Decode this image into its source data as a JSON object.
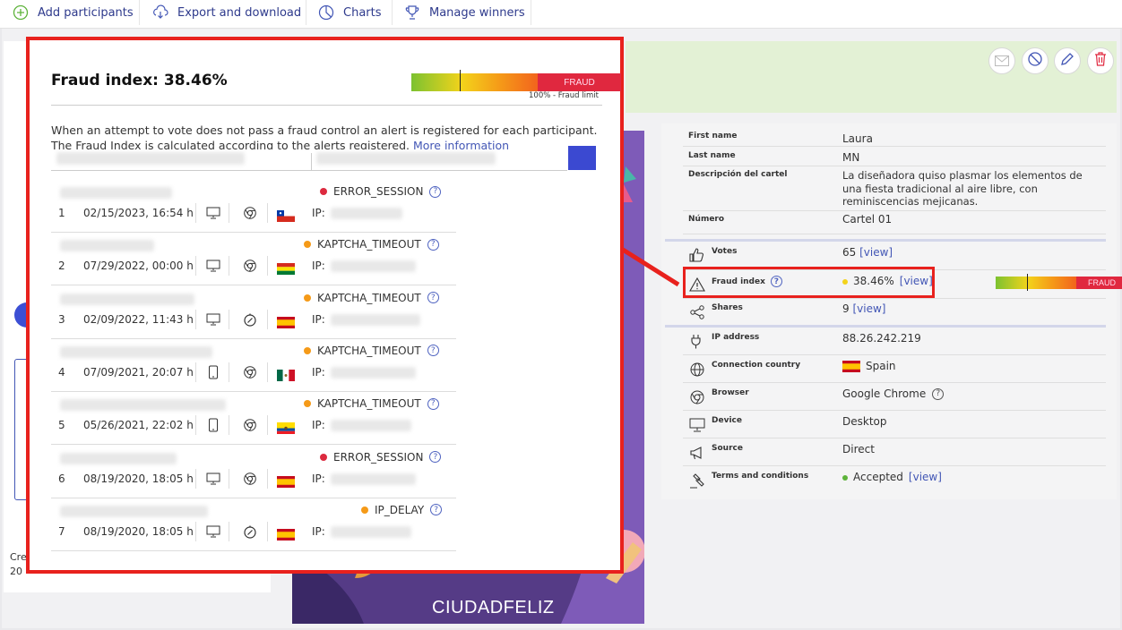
{
  "toolbar": {
    "items": [
      {
        "label": "Add participants",
        "icon": "plus-circle-icon"
      },
      {
        "label": "Export and download",
        "icon": "cloud-download-icon"
      },
      {
        "label": "Charts",
        "icon": "pie-chart-icon"
      },
      {
        "label": "Manage winners",
        "icon": "trophy-icon"
      }
    ]
  },
  "actions": [
    "mail-icon",
    "block-icon",
    "edit-icon",
    "delete-icon"
  ],
  "left_text": {
    "line1": "Cre",
    "line2": "20"
  },
  "poster": {
    "caption": "CIUDADFELIZ"
  },
  "details": {
    "first_name_label": "First name",
    "first_name": "Laura",
    "last_name_label": "Last name",
    "last_name": "MN",
    "desc_label": "Descripción del cartel",
    "desc": "La diseñadora quiso plasmar los elementos de una fiesta tradicional al aire libre, con reminiscencias mejicanas.",
    "number_label": "Número",
    "number": "Cartel 01",
    "votes_label": "Votes",
    "votes": "65",
    "fraud_label": "Fraud index",
    "fraud_value": "38.46%",
    "shares_label": "Shares",
    "shares": "9",
    "ip_label": "IP address",
    "ip": "88.26.242.219",
    "country_label": "Connection country",
    "country": "Spain",
    "browser_label": "Browser",
    "browser": "Google Chrome",
    "device_label": "Device",
    "device": "Desktop",
    "source_label": "Source",
    "source": "Direct",
    "terms_label": "Terms and conditions",
    "terms": "Accepted",
    "view_link": "[view]",
    "fraud_tag": "FRAUD",
    "fraud_level": 0.3846
  },
  "modal": {
    "title": "Fraud index: 38.46%",
    "gauge_fraud": "FRAUD",
    "gauge_limit": "100% - Fraud limit",
    "desc": "When an attempt to vote does not pass a fraud control an alert is registered for each participant. The Fraud Index is calculated according to the alerts registered.",
    "more_link": "More information",
    "ip_label": "IP:",
    "rows": [
      {
        "num": "1",
        "date": "02/15/2023, 16:54 h",
        "alert": "ERROR_SESSION",
        "alert_color": "#dc2a3f",
        "device": "desktop-icon",
        "browser": "chrome-icon",
        "flag": "chile-flag-icon"
      },
      {
        "num": "2",
        "date": "07/29/2022, 00:00 h",
        "alert": "KAPTCHA_TIMEOUT",
        "alert_color": "#f59a18",
        "device": "desktop-icon",
        "browser": "chrome-icon",
        "flag": "bolivia-flag-icon"
      },
      {
        "num": "3",
        "date": "02/09/2022, 11:43 h",
        "alert": "KAPTCHA_TIMEOUT",
        "alert_color": "#f59a18",
        "device": "desktop-icon",
        "browser": "safari-icon",
        "flag": "spain-flag-icon"
      },
      {
        "num": "4",
        "date": "07/09/2021, 20:07 h",
        "alert": "KAPTCHA_TIMEOUT",
        "alert_color": "#f59a18",
        "device": "mobile-icon",
        "browser": "chrome-icon",
        "flag": "mexico-flag-icon"
      },
      {
        "num": "5",
        "date": "05/26/2021, 22:02 h",
        "alert": "KAPTCHA_TIMEOUT",
        "alert_color": "#f59a18",
        "device": "mobile-icon",
        "browser": "chrome-icon",
        "flag": "ecuador-flag-icon"
      },
      {
        "num": "6",
        "date": "08/19/2020, 18:05 h",
        "alert": "ERROR_SESSION",
        "alert_color": "#dc2a3f",
        "device": "desktop-icon",
        "browser": "chrome-icon",
        "flag": "spain-flag-icon"
      },
      {
        "num": "7",
        "date": "08/19/2020, 18:05 h",
        "alert": "IP_DELAY",
        "alert_color": "#f59a18",
        "device": "desktop-icon",
        "browser": "safari-icon",
        "flag": "spain-flag-icon"
      }
    ]
  },
  "colors": {
    "accent": "#2e3a8c",
    "link": "#4256b5",
    "highlight": "#e8211d",
    "fraud": "#e0283f"
  }
}
